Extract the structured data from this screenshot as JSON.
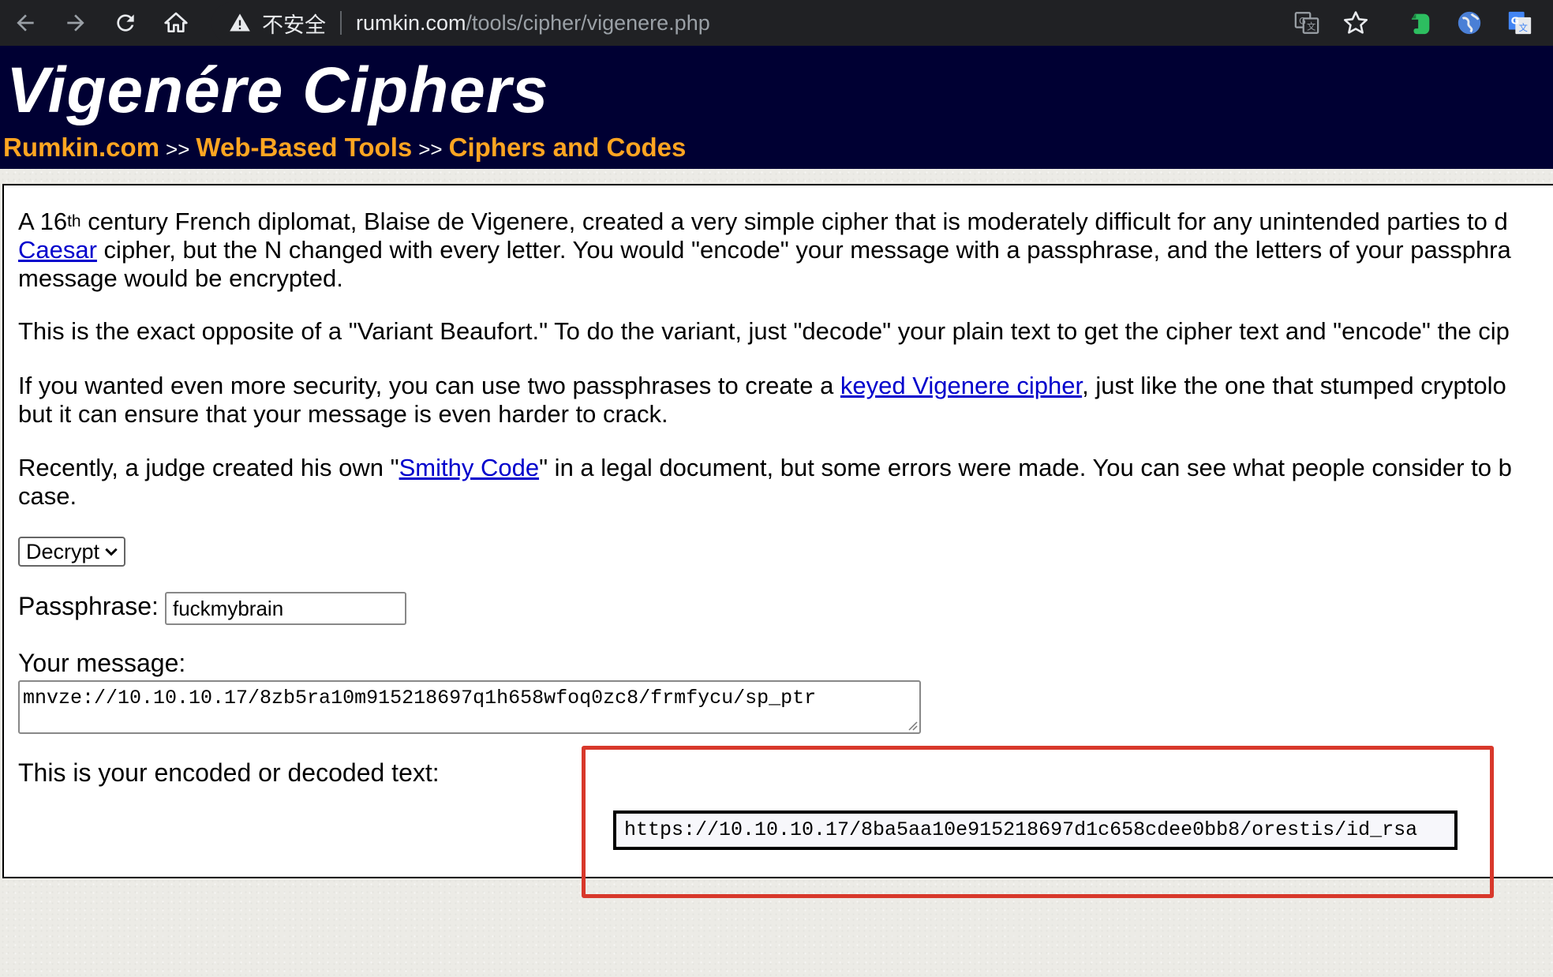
{
  "browser": {
    "security_label": "不安全",
    "url_host": "rumkin.com",
    "url_path": "/tools/cipher/vigenere.php"
  },
  "header": {
    "title": "Vigenére Ciphers",
    "breadcrumb": [
      {
        "label": "Rumkin.com"
      },
      {
        "label": "Web-Based Tools"
      },
      {
        "label": "Ciphers and Codes"
      }
    ],
    "separator": ">>"
  },
  "content": {
    "p1": {
      "prefix": "A 16",
      "sup": "th",
      "line1_rest": " century French diplomat, Blaise de Vigenere, created a very simple cipher that is moderately difficult for any unintended parties to d",
      "link": "Caesar",
      "line2_rest": " cipher, but the N changed with every letter. You would \"encode\" your message with a passphrase, and the letters of your passphra",
      "line3": "message would be encrypted."
    },
    "p2": "This is the exact opposite of a \"Variant Beaufort.\" To do the variant, just \"decode\" your plain text to get the cipher text and \"encode\" the cip",
    "p3": {
      "before": "If you wanted even more security, you can use two passphrases to create a ",
      "link": "keyed Vigenere cipher",
      "after": ", just like the one that stumped cryptolo",
      "line2": "but it can ensure that your message is even harder to crack."
    },
    "p4": {
      "before": "Recently, a judge created his own \"",
      "link": "Smithy Code",
      "after": "\" in a legal document, but some errors were made. You can see what people consider to b",
      "line2": "case."
    }
  },
  "form": {
    "mode_value": "Decrypt",
    "passphrase_label": "Passphrase:",
    "passphrase_value": "fuckmybrain",
    "message_label": "Your message:",
    "message_value": "mnvze://10.10.10.17/8zb5ra10m915218697q1h658wfoq0zc8/frmfycu/sp_ptr",
    "result_label": "This is your encoded or decoded text:",
    "result_value": "https://10.10.10.17/8ba5aa10e915218697d1c658cdee0bb8/orestis/id_rsa"
  },
  "colors": {
    "header_bg": "#000033",
    "breadcrumb": "#ffa521",
    "link": "#0000cc",
    "highlight": "#d8382b"
  }
}
